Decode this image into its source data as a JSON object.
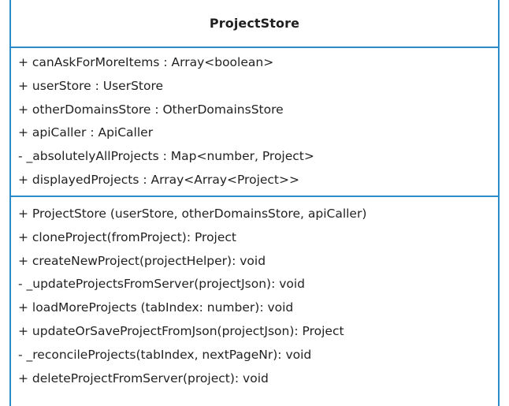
{
  "class_box": {
    "name": "ProjectStore",
    "attributes": [
      "+ canAskForMoreItems : Array<boolean>",
      "+ userStore : UserStore",
      "+ otherDomainsStore : OtherDomainsStore",
      "+ apiCaller : ApiCaller",
      "- _absolutelyAllProjects : Map<number, Project>",
      "+ displayedProjects : Array<Array<Project>>"
    ],
    "methods": [
      "+ ProjectStore (userStore, otherDomainsStore, apiCaller)",
      "+ cloneProject(fromProject): Project",
      "+ createNewProject(projectHelper): void",
      "- _updateProjectsFromServer(projectJson): void",
      "+ loadMoreProjects (tabIndex: number): void",
      "+ updateOrSaveProjectFromJson(projectJson): Project",
      "- _reconcileProjects(tabIndex, nextPageNr): void",
      "+ deleteProjectFromServer(project): void"
    ]
  },
  "colors": {
    "border": "#2e8bc9",
    "text": "#222222",
    "background": "#ffffff"
  }
}
